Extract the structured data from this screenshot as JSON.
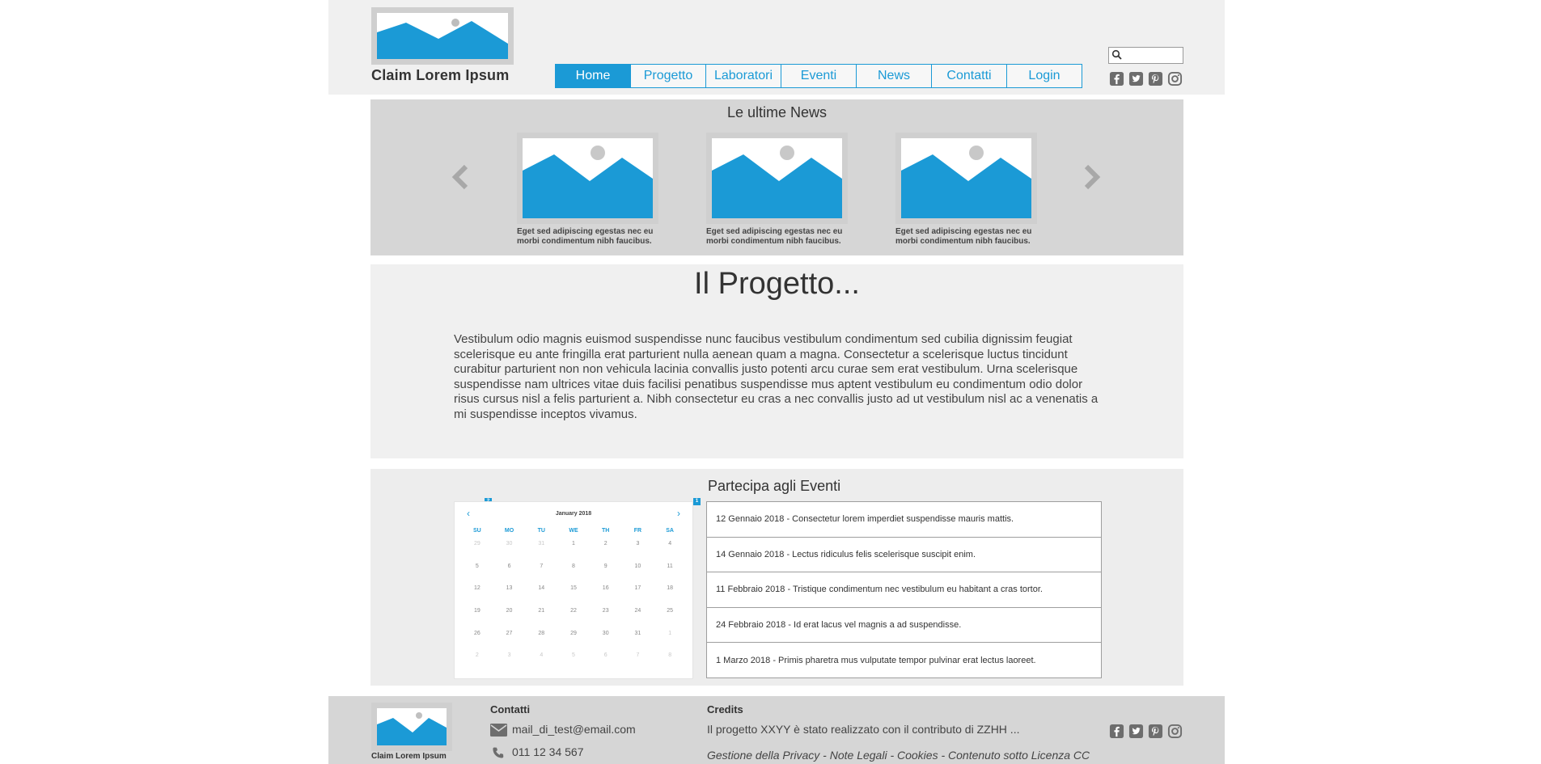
{
  "header": {
    "logo": "image-placeholder",
    "claim": "Claim Lorem Ipsum",
    "nav": [
      "Home",
      "Progetto",
      "Laboratori",
      "Eventi",
      "News",
      "Contatti",
      "Login"
    ],
    "active_nav": "Home",
    "search_placeholder": "",
    "socials": [
      "facebook-icon",
      "twitter-icon",
      "pinterest-icon",
      "instagram-icon"
    ]
  },
  "news": {
    "title": "Le ultime News",
    "items": [
      {
        "caption": "Eget sed adipiscing egestas nec eu morbi condimentum nibh faucibus."
      },
      {
        "caption": "Eget sed adipiscing egestas nec eu morbi condimentum nibh faucibus."
      },
      {
        "caption": "Eget sed adipiscing egestas nec eu morbi condimentum nibh faucibus."
      }
    ]
  },
  "progetto": {
    "title": "Il Progetto...",
    "text": "Vestibulum odio magnis euismod suspendisse nunc faucibus vestibulum condimentum sed cubilia dignissim feugiat scelerisque eu ante fringilla erat parturient nulla aenean quam a magna. Consectetur a scelerisque luctus tincidunt curabitur parturient non non vehicula lacinia convallis justo potenti arcu curae sem erat vestibulum. Urna scelerisque suspendisse nam ultrices vitae duis facilisi penatibus suspendisse mus aptent vestibulum eu condimentum odio dolor risus cursus nisl a felis parturient a. Nibh consectetur eu cras a nec convallis justo ad ut vestibulum nisl ac a venenatis a mi suspendisse inceptos vivamus."
  },
  "eventi": {
    "title": "Partecipa agli Eventi",
    "calendar": {
      "month": "January 2018",
      "prev": "‹",
      "next": "›",
      "tag_left": "2",
      "tag_right": "1",
      "weekdays": [
        "SU",
        "MO",
        "TU",
        "WE",
        "TH",
        "FR",
        "SA"
      ],
      "days": [
        [
          "29",
          "30",
          "31",
          "1",
          "2",
          "3",
          "4"
        ],
        [
          "5",
          "6",
          "7",
          "8",
          "9",
          "10",
          "11"
        ],
        [
          "12",
          "13",
          "14",
          "15",
          "16",
          "17",
          "18"
        ],
        [
          "19",
          "20",
          "21",
          "22",
          "23",
          "24",
          "25"
        ],
        [
          "26",
          "27",
          "28",
          "29",
          "30",
          "31",
          "1"
        ],
        [
          "2",
          "3",
          "4",
          "5",
          "6",
          "7",
          "8"
        ]
      ]
    },
    "list": [
      "12 Gennaio 2018 - Consectetur lorem imperdiet suspendisse mauris mattis.",
      "14 Gennaio 2018 - Lectus ridiculus felis scelerisque suscipit enim.",
      "11 Febbraio 2018 - Tristique condimentum nec vestibulum eu habitant a cras tortor.",
      "24 Febbraio 2018 - Id erat lacus vel magnis a ad suspendisse.",
      "1 Marzo 2018 - Primis pharetra mus vulputate tempor pulvinar erat lectus laoreet."
    ]
  },
  "footer": {
    "claim": "Claim Lorem Ipsum",
    "contatti_title": "Contatti",
    "email": "mail_di_test@email.com",
    "phone": "011 12 34 567",
    "credits_title": "Credits",
    "credits_text": "Il progetto XXYY è stato realizzato con il contributo di ZZHH ...",
    "legal": "Gestione della Privacy - Note Legali - Cookies - Contenuto sotto Licenza CC"
  },
  "colors": {
    "accent": "#1b9ad6",
    "placeholder_frame": "#cfcfcf",
    "header_bg": "#f0f0f0",
    "news_bg": "#d6d6d6"
  }
}
